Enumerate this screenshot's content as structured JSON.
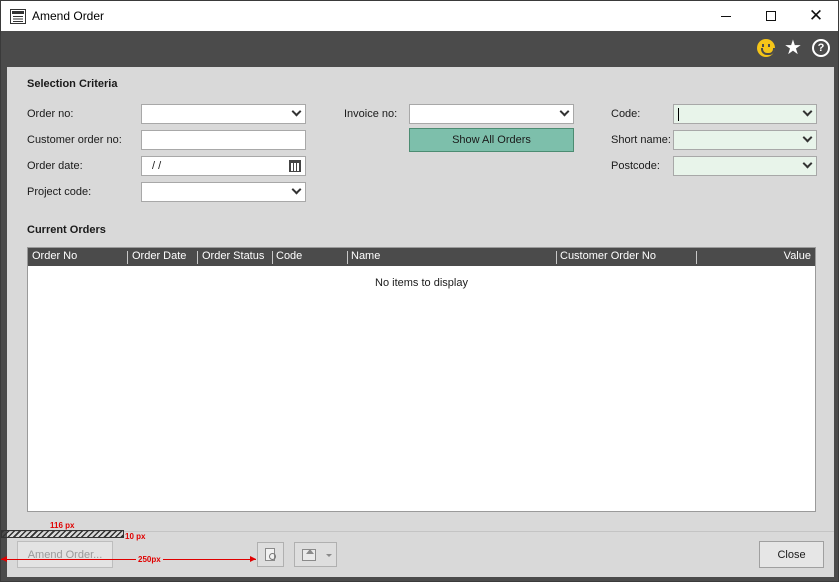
{
  "window": {
    "title": "Amend Order",
    "close_glyph": "✕"
  },
  "toolbar": {
    "icons": [
      "smiley-icon",
      "star-icon",
      "help-icon"
    ],
    "help_glyph": "?",
    "star_glyph": "★"
  },
  "selection": {
    "title": "Selection Criteria",
    "order_no_label": "Order no:",
    "customer_order_no_label": "Customer order no:",
    "order_date_label": "Order date:",
    "order_date_value": "/  /",
    "project_code_label": "Project code:",
    "invoice_no_label": "Invoice no:",
    "show_all_orders_label": "Show All Orders",
    "code_label": "Code:",
    "short_name_label": "Short name:",
    "postcode_label": "Postcode:"
  },
  "orders": {
    "title": "Current Orders",
    "columns": [
      "Order No",
      "Order Date",
      "Order Status",
      "Code",
      "Name",
      "Customer Order No",
      "Value"
    ],
    "empty_text": "No items to display"
  },
  "footer": {
    "amend_order_label": "Amend Order...",
    "close_label": "Close"
  },
  "annotations": {
    "width_top": "116 px",
    "height": "10 px",
    "width_arrow": "250px"
  },
  "colors": {
    "accent_green": "#7dbfab",
    "header_dark": "#4b4b4b",
    "panel": "#d9d9d9",
    "annotation_red": "#e00000"
  }
}
